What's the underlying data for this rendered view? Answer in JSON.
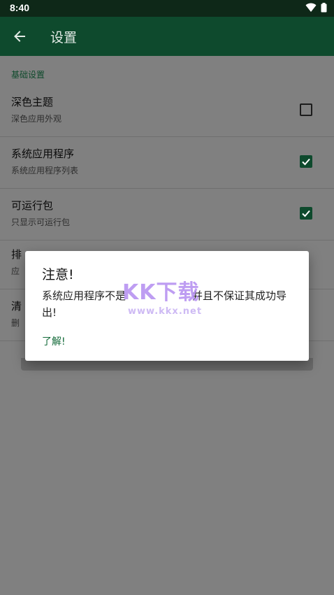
{
  "status_bar": {
    "time": "8:40"
  },
  "toolbar": {
    "title": "设置"
  },
  "section": {
    "header": "基础设置"
  },
  "prefs": [
    {
      "title": "深色主题",
      "subtitle": "深色应用外观",
      "checked": false
    },
    {
      "title": "系统应用程序",
      "subtitle": "系统应用程序列表",
      "checked": true
    },
    {
      "title": "可运行包",
      "subtitle": "只显示可运行包",
      "checked": true
    },
    {
      "title": "排",
      "subtitle": "应"
    },
    {
      "title": "清",
      "subtitle": "删"
    }
  ],
  "dialog": {
    "title": "注意!",
    "message": "系统应用程序不是",
    "message_tail": "并且不保证其成功导出!",
    "button": "了解!"
  },
  "watermark": {
    "logo": "KK下载",
    "url": "www.kkx.net"
  },
  "colors": {
    "primary": "#0e4a2d",
    "accent": "#146b3a",
    "scrim": "#808080"
  }
}
